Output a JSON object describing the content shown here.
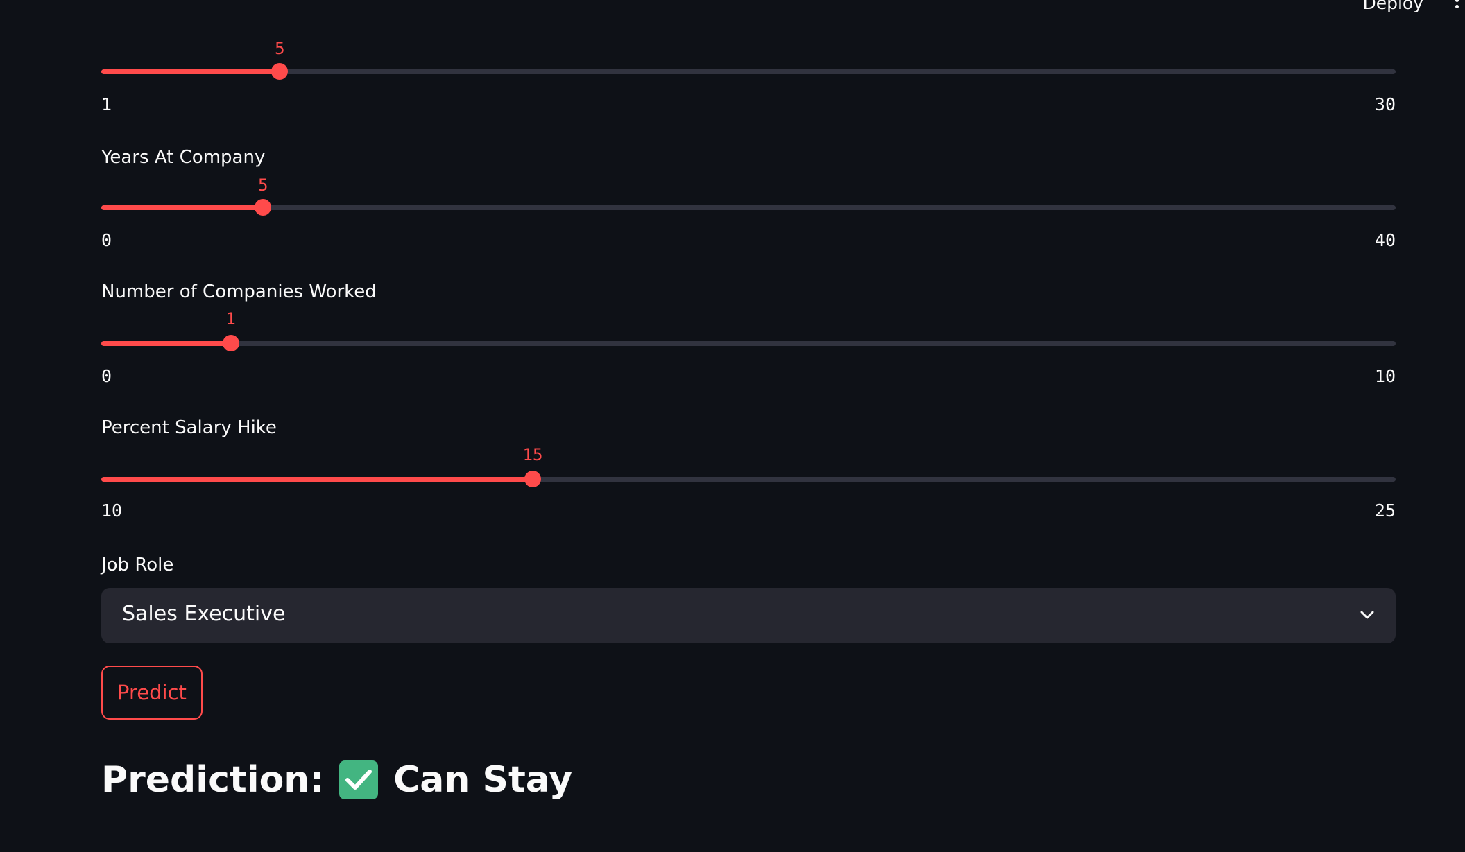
{
  "topbar": {
    "deploy_label": "Deploy"
  },
  "sliders": [
    {
      "label": "",
      "value": "5",
      "min": "1",
      "max": "30"
    },
    {
      "label": "Years At Company",
      "value": "5",
      "min": "0",
      "max": "40"
    },
    {
      "label": "Number of Companies Worked",
      "value": "1",
      "min": "0",
      "max": "10"
    },
    {
      "label": "Percent Salary Hike",
      "value": "15",
      "min": "10",
      "max": "25"
    }
  ],
  "job_role": {
    "label": "Job Role",
    "selected": "Sales Executive"
  },
  "predict_button": {
    "label": "Predict"
  },
  "result": {
    "prefix": "Prediction:",
    "text": "Can Stay",
    "icon": "check-mark-icon"
  },
  "colors": {
    "background": "#0e1117",
    "accent": "#ff4b4b",
    "track": "#31333f",
    "select_bg": "#262730",
    "success": "#43b581"
  }
}
